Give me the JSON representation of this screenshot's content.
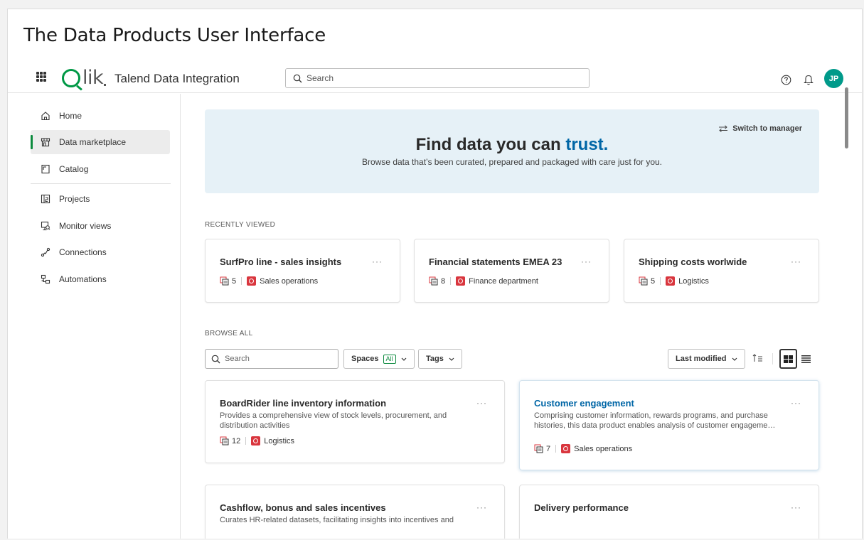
{
  "page_title": "The Data Products User Interface",
  "app": {
    "name": "Talend Data Integration",
    "search_placeholder": "Search",
    "avatar_initials": "JP"
  },
  "sidebar": {
    "items": [
      {
        "label": "Home",
        "icon": "home-icon"
      },
      {
        "label": "Data marketplace",
        "icon": "store-icon",
        "active": true
      },
      {
        "label": "Catalog",
        "icon": "catalog-icon"
      },
      {
        "label": "Projects",
        "icon": "projects-icon"
      },
      {
        "label": "Monitor views",
        "icon": "monitor-icon"
      },
      {
        "label": "Connections",
        "icon": "connections-icon"
      },
      {
        "label": "Automations",
        "icon": "automations-icon"
      }
    ]
  },
  "hero": {
    "title_prefix": "Find data you can ",
    "title_accent": "trust.",
    "subtitle": "Browse data that’s been curated, prepared and packaged with care just for you.",
    "switch_label": "Switch to manager"
  },
  "recently_viewed": {
    "label": "RECENTLY VIEWED",
    "cards": [
      {
        "title": "SurfPro line - sales insights",
        "count": "5",
        "space": "Sales operations"
      },
      {
        "title": "Financial statements EMEA 23",
        "count": "8",
        "space": "Finance department"
      },
      {
        "title": "Shipping costs worlwide",
        "count": "5",
        "space": "Logistics"
      }
    ]
  },
  "browse_all": {
    "label": "BROWSE ALL",
    "search_placeholder": "Search",
    "spaces_label": "Spaces",
    "spaces_badge": "All",
    "tags_label": "Tags",
    "sort_label": "Last modified",
    "cards": [
      {
        "title": "BoardRider line inventory information",
        "description": "Provides a comprehensive view of stock levels, procurement, and distribution activities",
        "count": "12",
        "space": "Logistics"
      },
      {
        "title": "Customer engagement",
        "description": "Comprising customer information, rewards programs, and purchase histories, this data product enables analysis of customer engageme…",
        "count": "7",
        "space": "Sales operations"
      },
      {
        "title": "Cashflow, bonus and sales incentives",
        "description": "Curates HR-related datasets, facilitating insights into incentives and"
      },
      {
        "title": "Delivery performance"
      }
    ]
  },
  "colors": {
    "brand_green": "#009845",
    "accent_blue": "#0066a6",
    "hero_bg": "#e6f1f7",
    "space_red": "#d9363e",
    "avatar": "#009a8a"
  }
}
